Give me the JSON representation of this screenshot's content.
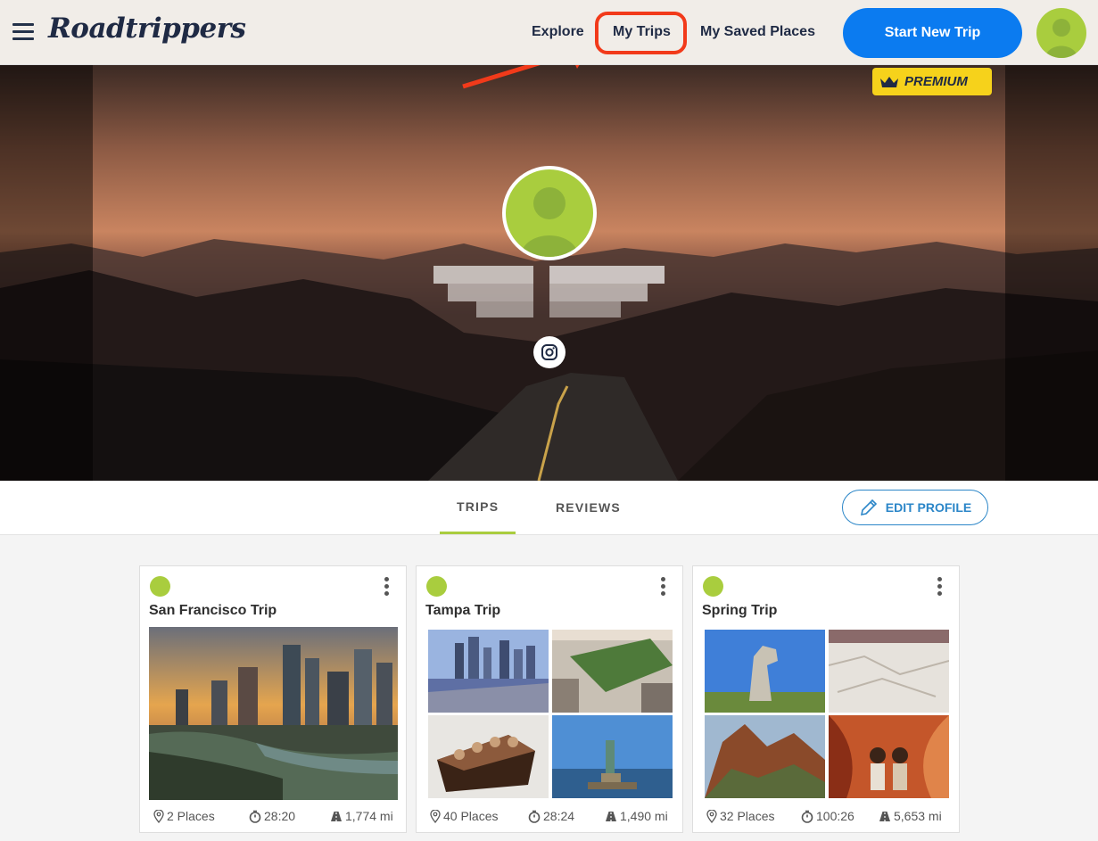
{
  "header": {
    "logo": "Roadtrippers",
    "nav": {
      "explore": "Explore",
      "my_trips": "My Trips",
      "saved": "My Saved Places"
    },
    "start_button": "Start New Trip"
  },
  "hero": {
    "premium_label": "PREMIUM"
  },
  "tabs": {
    "trips": "TRIPS",
    "reviews": "REVIEWS",
    "edit_profile": "EDIT PROFILE"
  },
  "trips": [
    {
      "title": "San Francisco Trip",
      "places": "2 Places",
      "time": "28:20",
      "distance": "1,774 mi"
    },
    {
      "title": "Tampa Trip",
      "places": "40 Places",
      "time": "28:24",
      "distance": "1,490 mi"
    },
    {
      "title": "Spring Trip",
      "places": "32 Places",
      "time": "100:26",
      "distance": "5,653 mi"
    }
  ],
  "colors": {
    "accent": "#0b7bf0",
    "brand_green": "#a9cd3e",
    "annotation_red": "#f23a1a",
    "premium_yellow": "#f6d21b"
  },
  "icons": [
    "menu-icon",
    "person-icon",
    "crown-icon",
    "instagram-icon",
    "pencil-icon",
    "kebab-icon",
    "pin-icon",
    "timer-icon",
    "road-icon"
  ]
}
